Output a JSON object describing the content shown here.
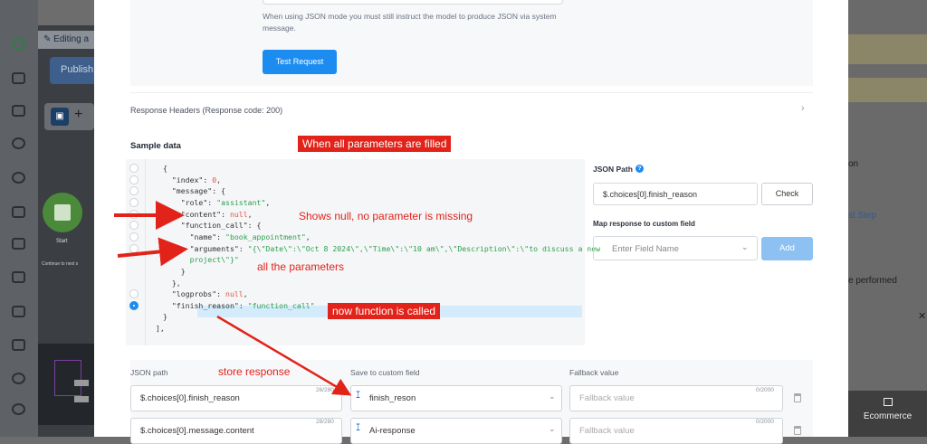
{
  "background_app": {
    "editing_label": "Editing a",
    "publish_label": "Publish",
    "start_label": "Start",
    "continue_label": "Continue to next s",
    "right_panel": {
      "item1": "on",
      "item2": "st Step",
      "item3": "e performed",
      "close": "✕",
      "ecommerce": "Ecommerce"
    }
  },
  "modal": {
    "json_hint": "When using JSON mode you must still instruct the model to produce JSON via system message.",
    "test_request": "Test Request",
    "response_headers": "Response Headers (Response code: 200)",
    "sample_data_title": "Sample data",
    "code_lines": [
      {
        "indent": "{",
        "parts": []
      },
      {
        "indent": "  ",
        "parts": [
          [
            "k",
            "\"index\""
          ],
          [
            "k",
            ": "
          ],
          [
            "n",
            "0"
          ],
          [
            "k",
            ","
          ]
        ]
      },
      {
        "indent": "  ",
        "parts": [
          [
            "k",
            "\"message\""
          ],
          [
            "k",
            ": {"
          ]
        ]
      },
      {
        "indent": "    ",
        "parts": [
          [
            "k",
            "\"role\""
          ],
          [
            "k",
            ": "
          ],
          [
            "s",
            "\"assistant\""
          ],
          [
            "k",
            ","
          ]
        ]
      },
      {
        "indent": "    ",
        "parts": [
          [
            "k",
            "\"content\""
          ],
          [
            "k",
            ": "
          ],
          [
            "n",
            "null"
          ],
          [
            "k",
            ","
          ]
        ]
      },
      {
        "indent": "    ",
        "parts": [
          [
            "k",
            "\"function_call\""
          ],
          [
            "k",
            ": {"
          ]
        ]
      },
      {
        "indent": "      ",
        "parts": [
          [
            "k",
            "\"name\""
          ],
          [
            "k",
            ": "
          ],
          [
            "s",
            "\"book_appointment\""
          ],
          [
            "k",
            ","
          ]
        ]
      },
      {
        "indent": "      ",
        "parts": [
          [
            "k",
            "\"arguments\""
          ],
          [
            "k",
            ": "
          ],
          [
            "s",
            "\"{\\\"Date\\\":\\\"Oct 8 2024\\\",\\\"Time\\\":\\\"10 am\\\",\\\"Description\\\":\\\"to discuss a new"
          ]
        ]
      },
      {
        "indent": "      ",
        "parts": [
          [
            "s",
            "project\\\"}\""
          ]
        ]
      },
      {
        "indent": "    ",
        "parts": [
          [
            "k",
            "}"
          ]
        ]
      },
      {
        "indent": "  ",
        "parts": [
          [
            "k",
            "},"
          ]
        ]
      },
      {
        "indent": "  ",
        "parts": [
          [
            "k",
            "\"logprobs\""
          ],
          [
            "k",
            ": "
          ],
          [
            "n",
            "null"
          ],
          [
            "k",
            ","
          ]
        ]
      },
      {
        "indent": "  ",
        "parts": [
          [
            "k",
            "\"finish_reason\""
          ],
          [
            "k",
            ": "
          ],
          [
            "s",
            "\"function_call\""
          ]
        ]
      },
      {
        "indent": "",
        "parts": [
          [
            "k",
            "}"
          ]
        ]
      },
      {
        "indent": "",
        "parts": [
          [
            "k",
            "],"
          ]
        ]
      }
    ],
    "json_path_label": "JSON Path",
    "json_path_value": "$.choices[0].finish_reason",
    "check_label": "Check",
    "map_label": "Map response to custom field",
    "map_placeholder": "Enter Field Name",
    "add_label": "Add",
    "table": {
      "col_json_path": "JSON path",
      "col_save": "Save to custom field",
      "col_fallback": "Fallback value",
      "rows": [
        {
          "path": "$.choices[0].finish_reason",
          "count": "26/280",
          "field": "finish_reson",
          "fallback": "Fallback value",
          "fb_count": "0/2000"
        },
        {
          "path": "$.choices[0].message.content",
          "count": "28/280",
          "field": "Ai-response",
          "fallback": "Fallback value",
          "fb_count": "0/2000"
        }
      ]
    }
  },
  "annotations": {
    "all_filled": "When all parameters are filled",
    "shows_null": "Shows null, no parameter is missing",
    "all_params": "all the parameters",
    "now_called": "now function is called",
    "store_response": "store response"
  },
  "colors": {
    "accent": "#1d8cf0",
    "annotation": "#e2231a"
  }
}
